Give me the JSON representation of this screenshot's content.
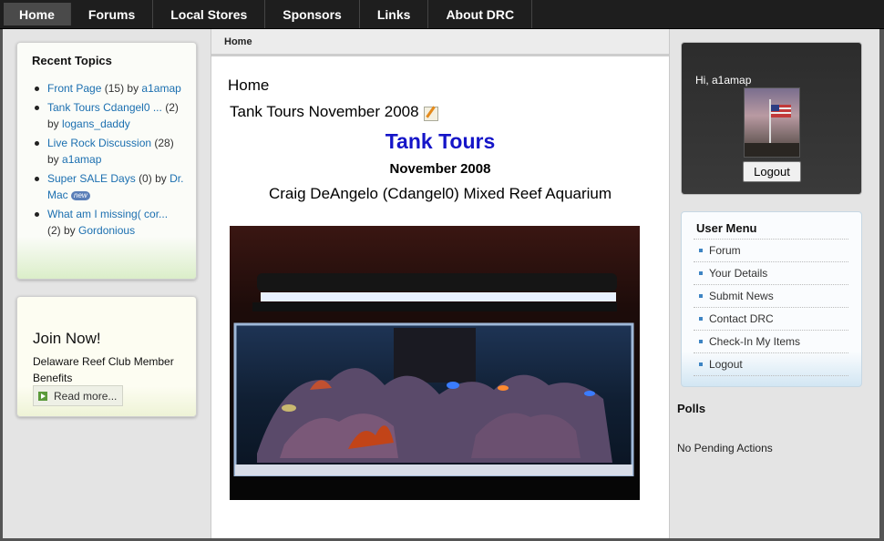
{
  "nav": {
    "items": [
      {
        "label": "Home",
        "active": true
      },
      {
        "label": "Forums"
      },
      {
        "label": "Local Stores"
      },
      {
        "label": "Sponsors"
      },
      {
        "label": "Links"
      },
      {
        "label": "About DRC"
      }
    ]
  },
  "recent_topics": {
    "heading": "Recent Topics",
    "items": [
      {
        "topic": "Front Page",
        "count": "(15) by",
        "user": "a1amap"
      },
      {
        "topic": "Tank Tours Cdangel0 ...",
        "count": "(2) by",
        "user": "logans_daddy"
      },
      {
        "topic": "Live Rock Discussion",
        "count": "(28) by",
        "user": "a1amap"
      },
      {
        "topic": "Super SALE Days",
        "count": "(0) by",
        "user": "Dr. Mac",
        "badge": "new"
      },
      {
        "topic": "What am I missing( cor...",
        "count": "(2) by",
        "user": "Gordonious"
      }
    ]
  },
  "join": {
    "heading": "Join Now!",
    "text": "Delaware Reef Club Member Benefits",
    "read_more": "Read more..."
  },
  "center": {
    "breadcrumb": "Home",
    "page_heading": "Home",
    "article_title": "Tank Tours November 2008",
    "title_main": "Tank Tours",
    "title_date": "November 2008",
    "title_sub": "Craig DeAngelo  (Cdangel0)  Mixed Reef Aquarium"
  },
  "user": {
    "greeting": "Hi, a1amap",
    "logout_button": "Logout"
  },
  "user_menu": {
    "heading": "User Menu",
    "items": [
      "Forum",
      "Your Details",
      "Submit News",
      "Contact DRC",
      "Check-In My Items",
      "Logout"
    ]
  },
  "polls": {
    "heading": "Polls",
    "status": "No Pending Actions"
  }
}
